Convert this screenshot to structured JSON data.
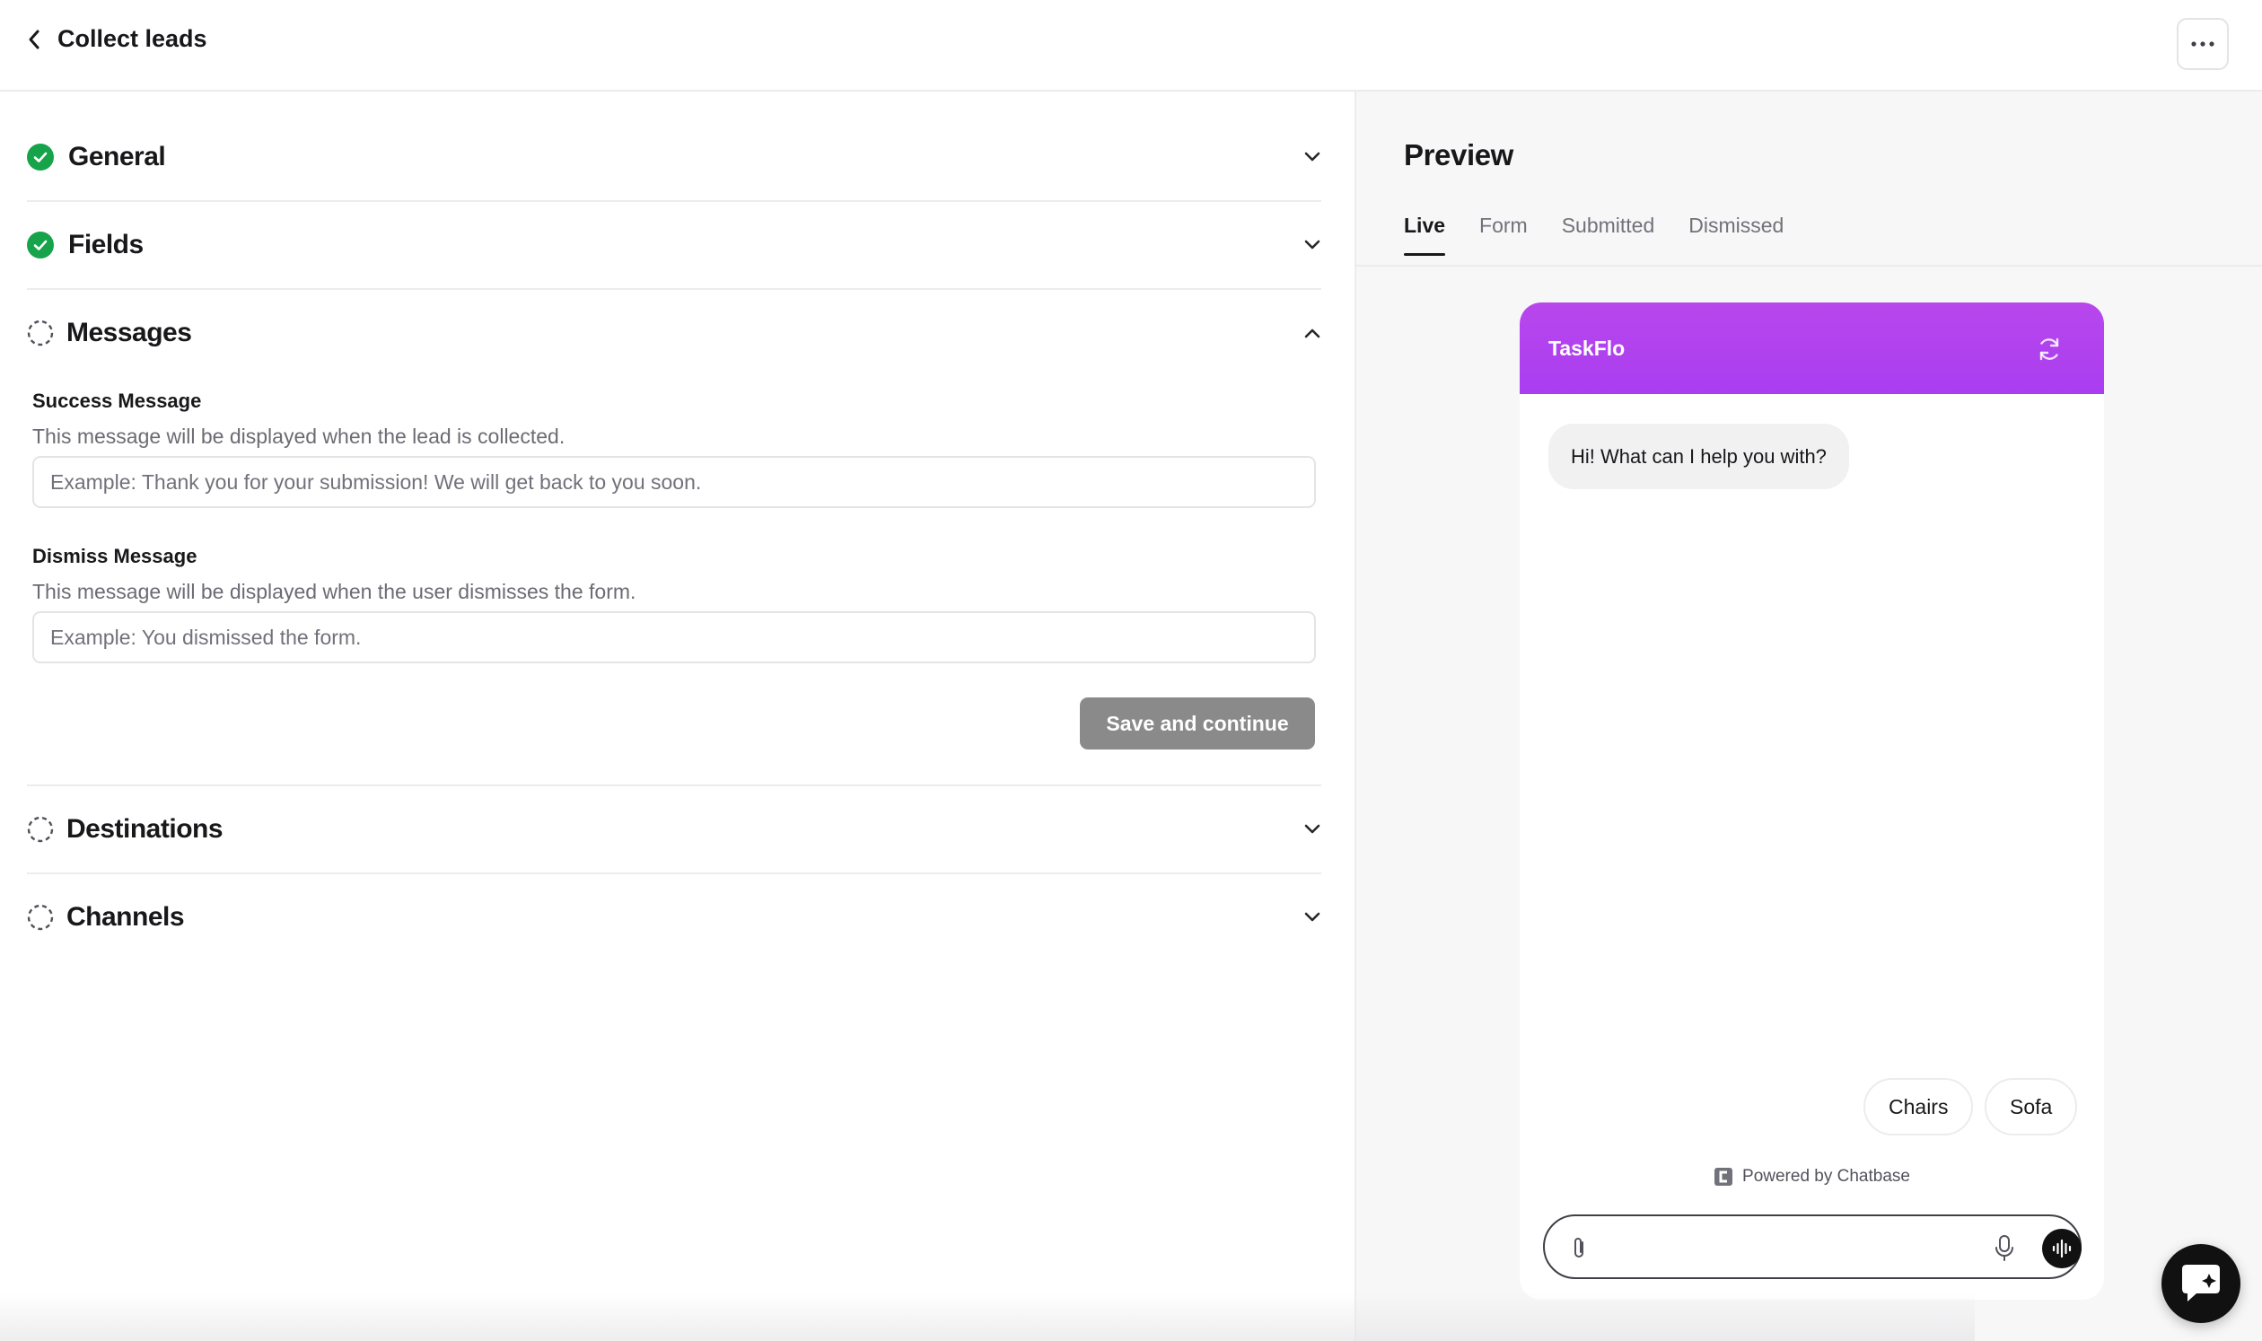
{
  "header": {
    "title": "Collect leads",
    "back_icon": "chevron-left-icon",
    "more_icon": "ellipsis-icon"
  },
  "sections": {
    "general": {
      "label": "General",
      "status": "complete"
    },
    "fields": {
      "label": "Fields",
      "status": "complete"
    },
    "messages": {
      "label": "Messages",
      "status": "incomplete",
      "expanded": true
    },
    "destinations": {
      "label": "Destinations",
      "status": "incomplete"
    },
    "channels": {
      "label": "Channels",
      "status": "incomplete"
    }
  },
  "messages_form": {
    "success": {
      "label": "Success Message",
      "help": "This message will be displayed when the lead is collected.",
      "value": "",
      "placeholder": "Example: Thank you for your submission! We will get back to you soon."
    },
    "dismiss": {
      "label": "Dismiss Message",
      "help": "This message will be displayed when the user dismisses the form.",
      "value": "",
      "placeholder": "Example: You dismissed the form."
    },
    "save_label": "Save and continue"
  },
  "preview": {
    "title": "Preview",
    "tabs": [
      {
        "label": "Live",
        "active": true
      },
      {
        "label": "Form",
        "active": false
      },
      {
        "label": "Submitted",
        "active": false
      },
      {
        "label": "Dismissed",
        "active": false
      }
    ],
    "chat": {
      "bot_name": "TaskFlo",
      "header_color": "#b145ee",
      "greeting": "Hi! What can I help you with?",
      "suggestions": [
        "Chairs",
        "Sofa"
      ],
      "powered_by": "Powered by Chatbase",
      "composer_value": "",
      "composer_placeholder": ""
    }
  },
  "colors": {
    "success_green": "#16a34a",
    "accent_purple": "#b145ee",
    "disabled_button": "#8a8a8a"
  }
}
